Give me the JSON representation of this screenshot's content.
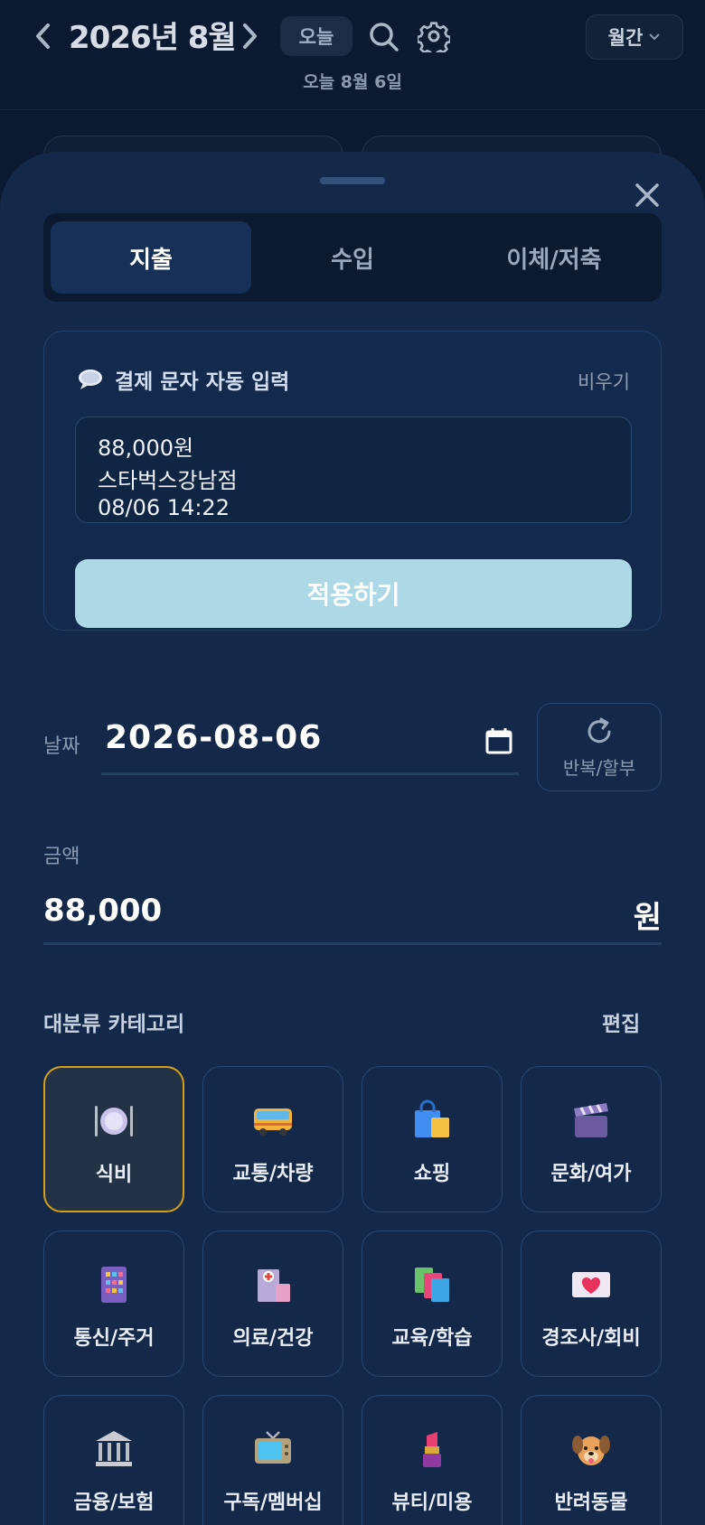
{
  "header": {
    "month_title": "2026년 8월",
    "today_button": "오늘",
    "today_subtitle": "오늘 8월 6일",
    "view_mode": "월간"
  },
  "tabs": [
    {
      "label": "지출",
      "active": true
    },
    {
      "label": "수입",
      "active": false
    },
    {
      "label": "이체/저축",
      "active": false
    }
  ],
  "sms": {
    "title": "결제 문자 자동 입력",
    "clear_label": "비우기",
    "lines": [
      "88,000원",
      "스타벅스강남점",
      "08/06 14:22"
    ],
    "apply_label": "적용하기"
  },
  "date": {
    "label": "날짜",
    "value": "2026-08-06",
    "repeat_label": "반복/할부"
  },
  "amount": {
    "label": "금액",
    "value": "88,000",
    "unit": "원"
  },
  "categories": {
    "title": "대분류 카테고리",
    "edit_label": "편집",
    "items": [
      {
        "label": "식비",
        "icon": "plate-icon",
        "selected": true
      },
      {
        "label": "교통/차량",
        "icon": "bus-icon"
      },
      {
        "label": "쇼핑",
        "icon": "shopping-bag-icon"
      },
      {
        "label": "문화/여가",
        "icon": "clapperboard-icon"
      },
      {
        "label": "통신/주거",
        "icon": "building-icon"
      },
      {
        "label": "의료/건강",
        "icon": "hospital-icon"
      },
      {
        "label": "교육/학습",
        "icon": "books-icon"
      },
      {
        "label": "경조사/회비",
        "icon": "love-letter-icon"
      },
      {
        "label": "금융/보험",
        "icon": "bank-icon"
      },
      {
        "label": "구독/멤버십",
        "icon": "tv-icon"
      },
      {
        "label": "뷰티/미용",
        "icon": "lipstick-icon"
      },
      {
        "label": "반려동물",
        "icon": "dog-icon"
      }
    ]
  },
  "colors": {
    "background": "#0b1a30",
    "sheet": "#14294a",
    "apply_button": "#add8e6",
    "selected_border": "#d4a017"
  }
}
